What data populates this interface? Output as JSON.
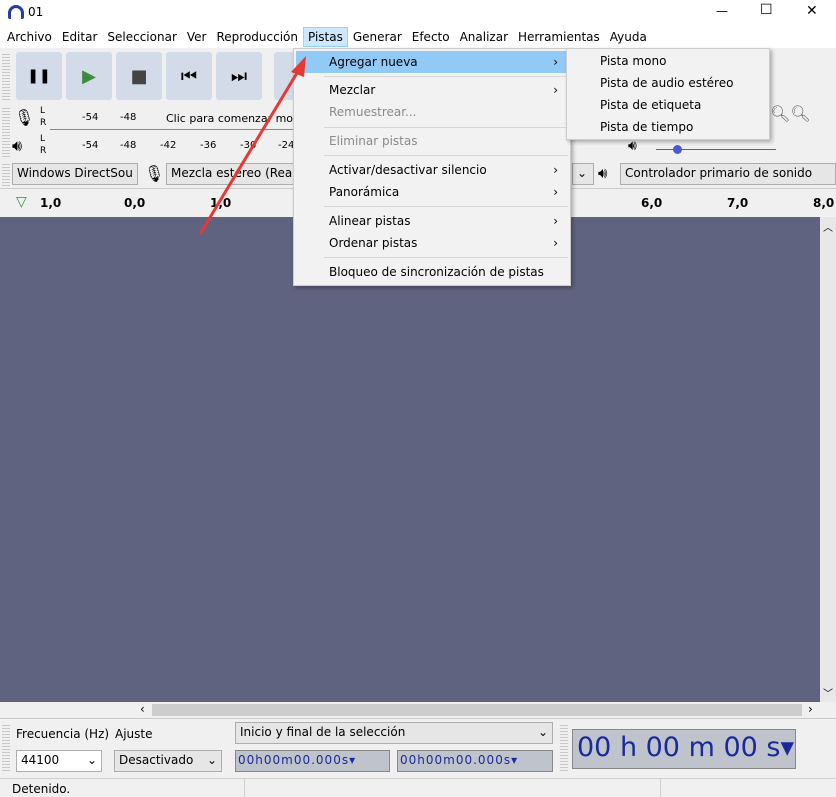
{
  "window": {
    "title": "01",
    "minimize": "—",
    "maximize": "☐",
    "close": "✕"
  },
  "menubar": [
    "Archivo",
    "Editar",
    "Seleccionar",
    "Ver",
    "Reproducción",
    "Pistas",
    "Generar",
    "Efecto",
    "Analizar",
    "Herramientas",
    "Ayuda"
  ],
  "transport": {
    "pause": "❚❚",
    "play": "▶",
    "stop": "■",
    "skip_start": "⏮",
    "skip_end": "⏭"
  },
  "meters": {
    "rec_ticks": [
      "-54",
      "-48"
    ],
    "rec_hint": "Clic para comenzar monito",
    "play_ticks": [
      "-54",
      "-48",
      "-42",
      "-36",
      "-30",
      "-24"
    ],
    "L": "L",
    "R": "R"
  },
  "devices": {
    "host": "Windows DirectSou",
    "input": "Mezcla estéreo (Realtek",
    "output": "Controlador primario de sonido"
  },
  "ruler": [
    "1,0",
    "0,0",
    "1,0",
    "6,0",
    "7,0",
    "8,0"
  ],
  "pistas_menu": {
    "items": [
      {
        "label": "Agregar nueva",
        "submenu": true,
        "highlighted": true
      },
      {
        "label": "Mezclar",
        "submenu": true
      },
      {
        "label": "Remuestrear...",
        "disabled": true
      },
      {
        "label": "Eliminar pistas",
        "disabled": true
      },
      {
        "label": "Activar/desactivar silencio",
        "submenu": true
      },
      {
        "label": "Panorámica",
        "submenu": true
      },
      {
        "label": "Alinear pistas",
        "submenu": true
      },
      {
        "label": "Ordenar pistas",
        "submenu": true
      },
      {
        "label": "Bloqueo de sincronización de pistas"
      }
    ],
    "arrow": "›"
  },
  "agregar_submenu": [
    "Pista mono",
    "Pista de audio estéreo",
    "Pista de etiqueta",
    "Pista de tiempo"
  ],
  "bottom": {
    "freq_label": "Frecuencia (Hz)",
    "freq_value": "44100",
    "snap_label": "Ajuste",
    "snap_value": "Desactivado",
    "selection_mode": "Inicio y final de la selección",
    "sel_start": "00h00m00.000s",
    "sel_end": "00h00m00.000s",
    "position": "00 h 00 m 00 s"
  },
  "status": "Detenido.",
  "colors": {
    "track_bg": "#60637f",
    "menu_highlight": "#91c9f7",
    "arrow": "#e53935",
    "time_text": "#1a2a9a"
  }
}
